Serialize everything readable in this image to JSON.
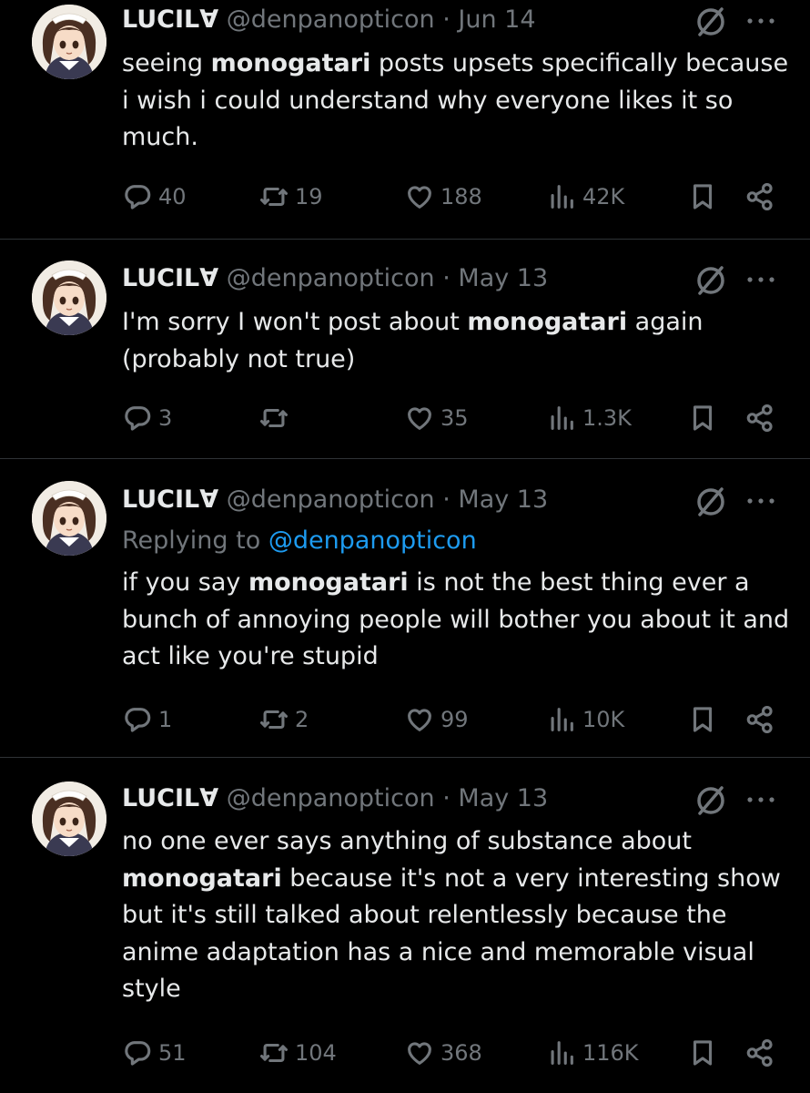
{
  "tweets": [
    {
      "name": "LUCILꓯ",
      "handle": "@denpanopticon",
      "dot": "·",
      "date": "Jun 14",
      "replying_label": "",
      "replying_mention": "",
      "body_parts": [
        {
          "t": "seeing ",
          "b": false
        },
        {
          "t": "monogatari",
          "b": true
        },
        {
          "t": " posts upsets specifically because i wish i could understand why everyone likes it so much.",
          "b": false
        }
      ],
      "replies": "40",
      "retweets": "19",
      "likes": "188",
      "views": "42K"
    },
    {
      "name": "LUCILꓯ",
      "handle": "@denpanopticon",
      "dot": "·",
      "date": "May 13",
      "replying_label": "",
      "replying_mention": "",
      "body_parts": [
        {
          "t": "I'm sorry I won't post about ",
          "b": false
        },
        {
          "t": "monogatari",
          "b": true
        },
        {
          "t": " again (probably not true)",
          "b": false
        }
      ],
      "replies": "3",
      "retweets": "",
      "likes": "35",
      "views": "1.3K"
    },
    {
      "name": "LUCILꓯ",
      "handle": "@denpanopticon",
      "dot": "·",
      "date": "May 13",
      "replying_label": "Replying to",
      "replying_mention": "@denpanopticon",
      "body_parts": [
        {
          "t": "if you say ",
          "b": false
        },
        {
          "t": "monogatari",
          "b": true
        },
        {
          "t": " is not the best thing ever a bunch of annoying people will bother you about it and act like you're stupid",
          "b": false
        }
      ],
      "replies": "1",
      "retweets": "2",
      "likes": "99",
      "views": "10K"
    },
    {
      "name": "LUCILꓯ",
      "handle": "@denpanopticon",
      "dot": "·",
      "date": "May 13",
      "replying_label": "",
      "replying_mention": "",
      "body_parts": [
        {
          "t": "no one ever says anything of substance about ",
          "b": false
        },
        {
          "t": "monogatari",
          "b": true
        },
        {
          "t": " because it's not a very interesting show but it's still talked about relentlessly because the anime adaptation has a nice and memorable visual style",
          "b": false
        }
      ],
      "replies": "51",
      "retweets": "104",
      "likes": "368",
      "views": "116K"
    }
  ],
  "icons": {
    "reply": "reply-icon",
    "retweet": "retweet-icon",
    "like": "heart-icon",
    "views": "views-icon",
    "bookmark": "bookmark-icon",
    "share": "share-icon",
    "verified": "slashed-circle-icon",
    "more": "more-icon"
  },
  "colors": {
    "background": "#000000",
    "text": "#e7e9ea",
    "muted": "#71767b",
    "link": "#1d9bf0",
    "divider": "#2f3336"
  }
}
